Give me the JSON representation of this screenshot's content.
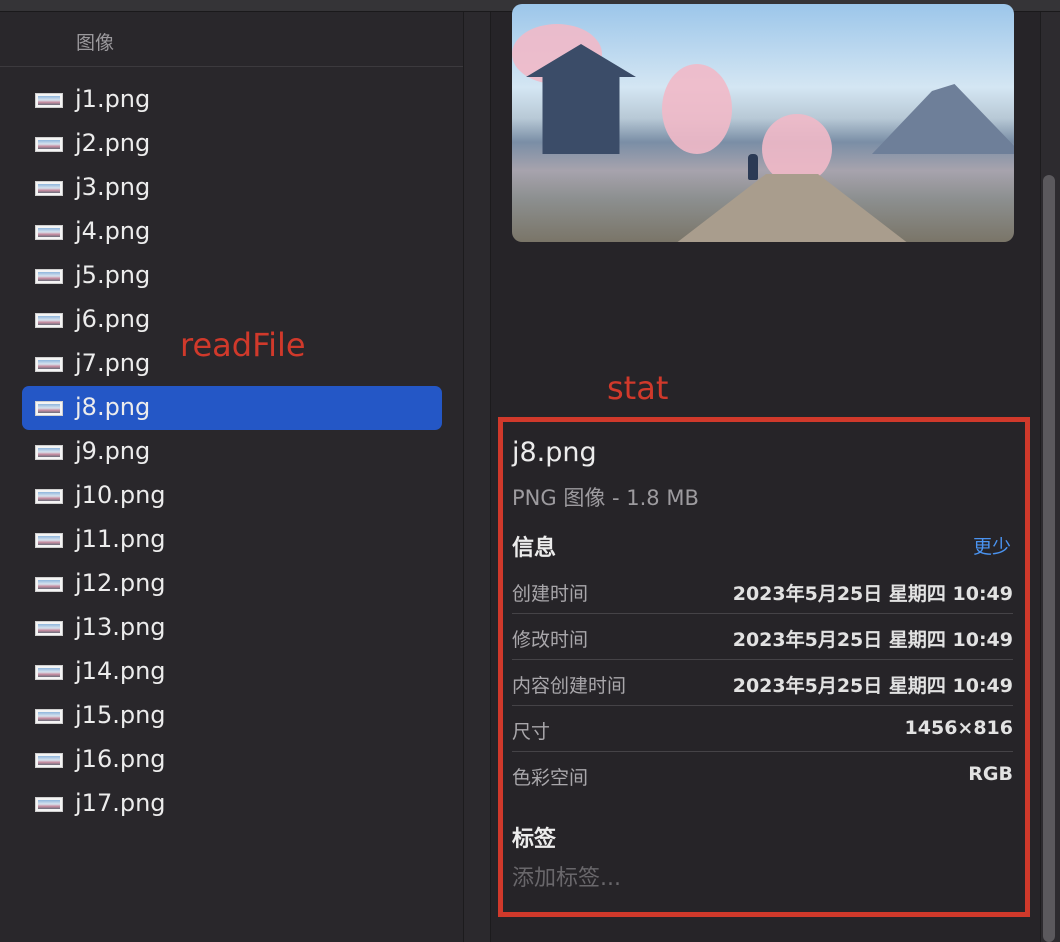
{
  "column": {
    "header": "图像"
  },
  "files": [
    {
      "name": "j1.png"
    },
    {
      "name": "j2.png"
    },
    {
      "name": "j3.png"
    },
    {
      "name": "j4.png"
    },
    {
      "name": "j5.png"
    },
    {
      "name": "j6.png"
    },
    {
      "name": "j7.png"
    },
    {
      "name": "j8.png",
      "selected": true
    },
    {
      "name": "j9.png"
    },
    {
      "name": "j10.png"
    },
    {
      "name": "j11.png"
    },
    {
      "name": "j12.png"
    },
    {
      "name": "j13.png"
    },
    {
      "name": "j14.png"
    },
    {
      "name": "j15.png"
    },
    {
      "name": "j16.png"
    },
    {
      "name": "j17.png"
    }
  ],
  "annotations": {
    "readfile": "readFile",
    "stat": "stat",
    "color": "#d0392b"
  },
  "info": {
    "title": "j8.png",
    "subtitle": "PNG 图像 - 1.8 MB",
    "section_label": "信息",
    "less_label": "更少",
    "rows": [
      {
        "key": "创建时间",
        "value": "2023年5月25日 星期四 10:49"
      },
      {
        "key": "修改时间",
        "value": "2023年5月25日 星期四 10:49"
      },
      {
        "key": "内容创建时间",
        "value": "2023年5月25日 星期四 10:49"
      },
      {
        "key": "尺寸",
        "value": "1456×816"
      },
      {
        "key": "色彩空间",
        "value": "RGB"
      }
    ],
    "tags_label": "标签",
    "add_tag_placeholder": "添加标签..."
  },
  "colors": {
    "selection": "#2457c6",
    "link": "#4a93f0",
    "background": "#262428"
  }
}
